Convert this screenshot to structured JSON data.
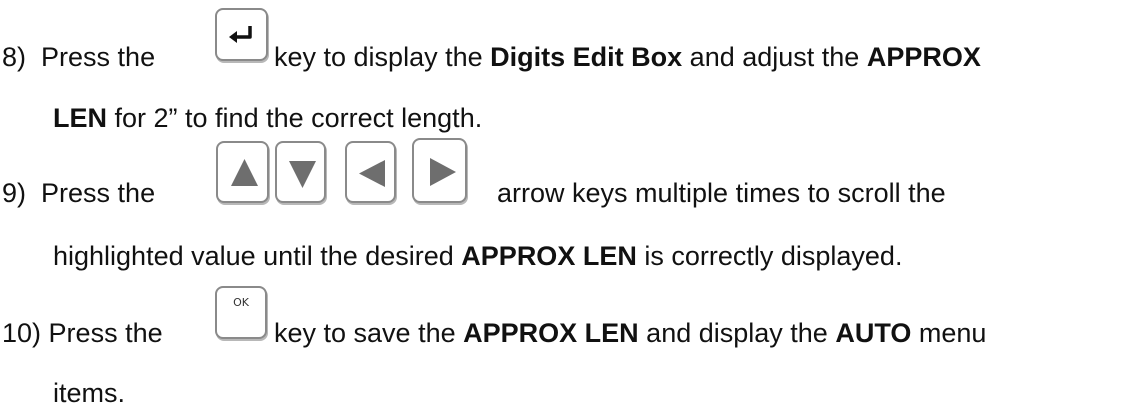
{
  "steps": [
    {
      "number": "8)",
      "line1": {
        "pre": "Press the",
        "post": "key to display the",
        "b1": "Digits Edit Box",
        "mid": "and adjust the",
        "b2": "APPROX"
      },
      "line2": {
        "b1": "LEN",
        "rest": "for 2” to find the correct length."
      },
      "key_icon": "enter-key-icon"
    },
    {
      "number": "9)",
      "line1": {
        "pre": "Press the",
        "post": "arrow keys multiple times to scroll the"
      },
      "line2": {
        "pre": "highlighted value until the desired",
        "b1": "APPROX LEN",
        "post": "is correctly displayed."
      },
      "key_icons": [
        "up-arrow-key-icon",
        "down-arrow-key-icon",
        "left-arrow-key-icon",
        "right-arrow-key-icon"
      ]
    },
    {
      "number": "10)",
      "line1": {
        "pre": "Press the",
        "post": "key to save the",
        "b1": "APPROX LEN",
        "mid": "and display the",
        "b2": "AUTO",
        "end": "menu"
      },
      "line2": {
        "rest": "items."
      },
      "key_label": "OK"
    }
  ],
  "colors": {
    "text": "#111111",
    "key_border": "#8a8a8a",
    "key_glyph": "#6e6e6e"
  }
}
